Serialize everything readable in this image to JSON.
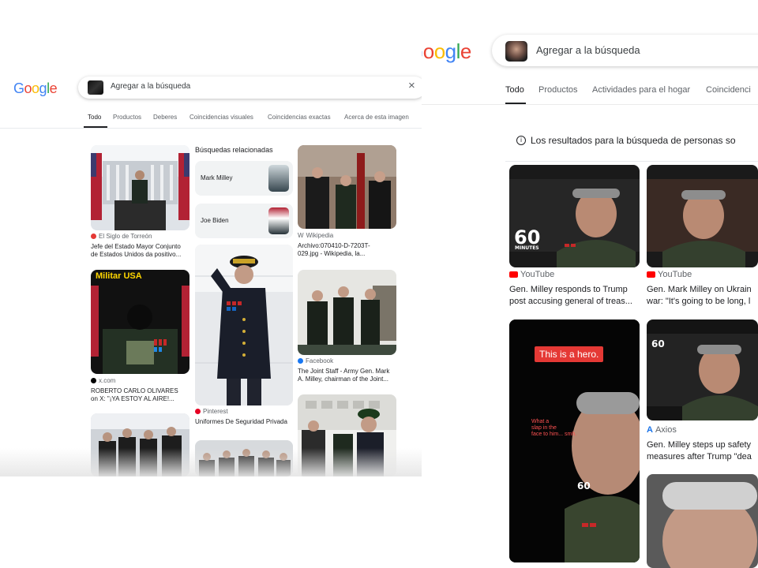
{
  "left": {
    "logo": "Google",
    "search": {
      "placeholder": "Agregar a la búsqueda",
      "close_glyph": "×"
    },
    "tabs": [
      "Todo",
      "Productos",
      "Deberes",
      "Coincidencias visuales",
      "Coincidencias exactas",
      "Acerca de esta imagen"
    ],
    "related": {
      "title": "Búsquedas relacionadas",
      "items": [
        "Mark Milley",
        "Joe Biden"
      ]
    },
    "results": [
      {
        "source": "El Siglo de Torreón",
        "source_color": "#e53935",
        "caption_1": "Jefe del Estado Mayor Conjunto",
        "caption_2": "de Estados Unidos da positivo..."
      },
      {
        "source": "Wikipedia",
        "source_color": "#5f6368",
        "caption_1": "Archivo:070410-D-7203T-",
        "caption_2": "029.jpg - Wikipedia, la..."
      },
      {
        "source": "x.com",
        "source_color": "#000000",
        "caption_1": "ROBERTO CARLO OLIVARES",
        "caption_2": "on X: \"¡YA ESTOY AL AIRE!..."
      },
      {
        "source": "Pinterest",
        "source_color": "#e60023",
        "caption_1": "Uniformes De Seguridad Privada",
        "caption_2": ""
      },
      {
        "source": "Facebook",
        "source_color": "#1877f2",
        "caption_1": "The Joint Staff - Army Gen. Mark",
        "caption_2": "A. Milley, chairman of the Joint..."
      }
    ],
    "banner_text": "Militar USA"
  },
  "right": {
    "logo": "Google",
    "search": {
      "placeholder": "Agregar a la búsqueda"
    },
    "tabs": [
      "Todo",
      "Productos",
      "Actividades para el hogar",
      "Coincidenci"
    ],
    "notice": "Los resultados para la búsqueda de personas so",
    "results": [
      {
        "source": "YouTube",
        "caption_1": "Gen. Milley responds to Trump",
        "caption_2": "post accusing general of treas..."
      },
      {
        "source": "YouTube",
        "caption_1": "Gen. Mark Milley on Ukrain",
        "caption_2": "war: \"It's going to be long, l"
      },
      {
        "source": "Axios",
        "caption_1": "Gen. Milley steps up safety",
        "caption_2": "measures after Trump \"dea"
      }
    ],
    "video_label": "This is a hero.",
    "video_subtitle_1": "What a",
    "video_subtitle_2": "slap in the",
    "video_subtitle_3": "face to him... smh.",
    "badge_60": "60",
    "badge_minutes": "MINUTES"
  }
}
